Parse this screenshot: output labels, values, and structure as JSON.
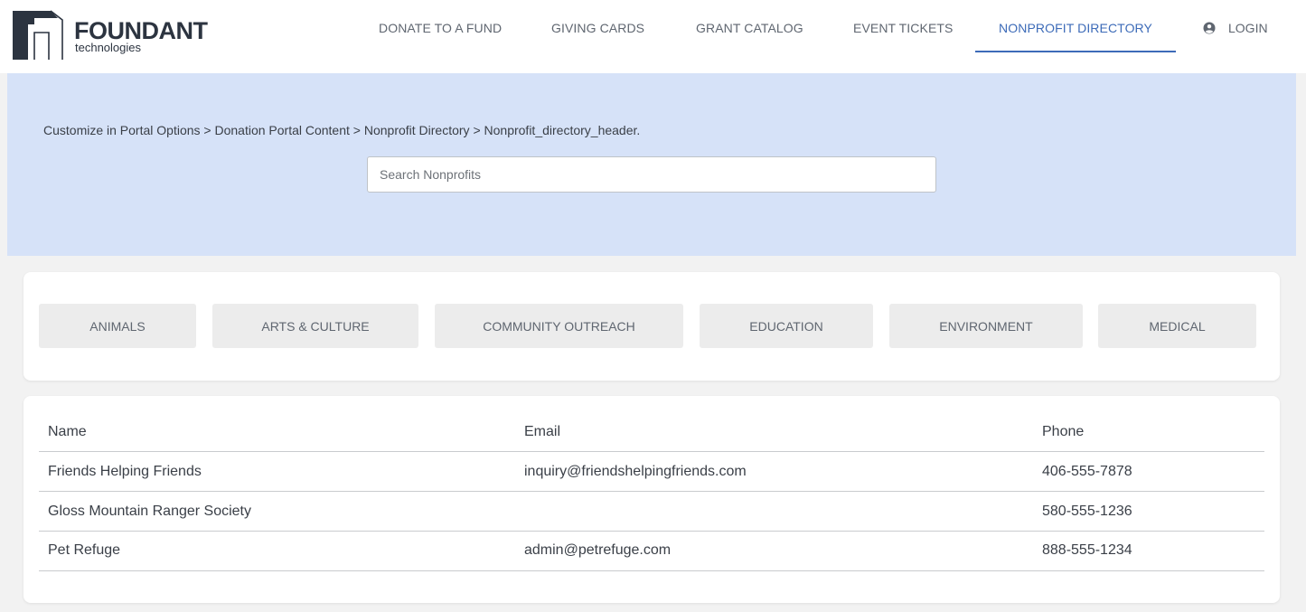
{
  "brand": {
    "name": "FOUNDANT",
    "sub": "technologies"
  },
  "nav": {
    "items": [
      {
        "label": "DONATE TO A FUND"
      },
      {
        "label": "GIVING CARDS"
      },
      {
        "label": "GRANT CATALOG"
      },
      {
        "label": "EVENT TICKETS"
      },
      {
        "label": "NONPROFIT DIRECTORY",
        "active": true
      }
    ],
    "login_label": "LOGIN",
    "login_icon": "user-circle-icon"
  },
  "hero": {
    "breadcrumb": "Customize in Portal Options > Donation Portal Content > Nonprofit Directory > Nonprofit_directory_header.",
    "search_placeholder": "Search Nonprofits",
    "search_value": ""
  },
  "categories": [
    "ANIMALS",
    "ARTS & CULTURE",
    "COMMUNITY OUTREACH",
    "EDUCATION",
    "ENVIRONMENT",
    "MEDICAL"
  ],
  "table": {
    "headers": {
      "name": "Name",
      "email": "Email",
      "phone": "Phone"
    },
    "rows": [
      {
        "name": "Friends Helping Friends",
        "email": "inquiry@friendshelpingfriends.com",
        "phone": "406-555-7878"
      },
      {
        "name": "Gloss Mountain Ranger Society",
        "email": "",
        "phone": "580-555-1236"
      },
      {
        "name": "Pet Refuge",
        "email": "admin@petrefuge.com",
        "phone": "888-555-1234"
      }
    ]
  },
  "colors": {
    "accent": "#3d6bb8",
    "hero_bg": "#d6e2f8",
    "page_bg": "#f2f2f2",
    "chip_bg": "#ececec"
  }
}
